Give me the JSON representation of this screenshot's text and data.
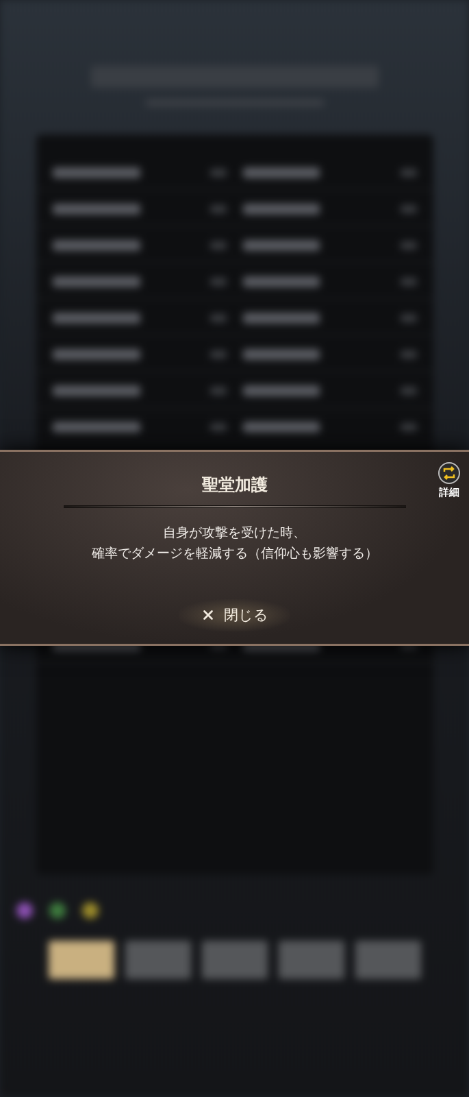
{
  "dialog": {
    "title": "聖堂加護",
    "detail_button": {
      "label": "詳細"
    },
    "description": [
      "自身が攻撃を受けた時、",
      "確率でダメージを軽減する（信仰心も影響する）"
    ],
    "close_button": {
      "label": "閉じる"
    }
  }
}
